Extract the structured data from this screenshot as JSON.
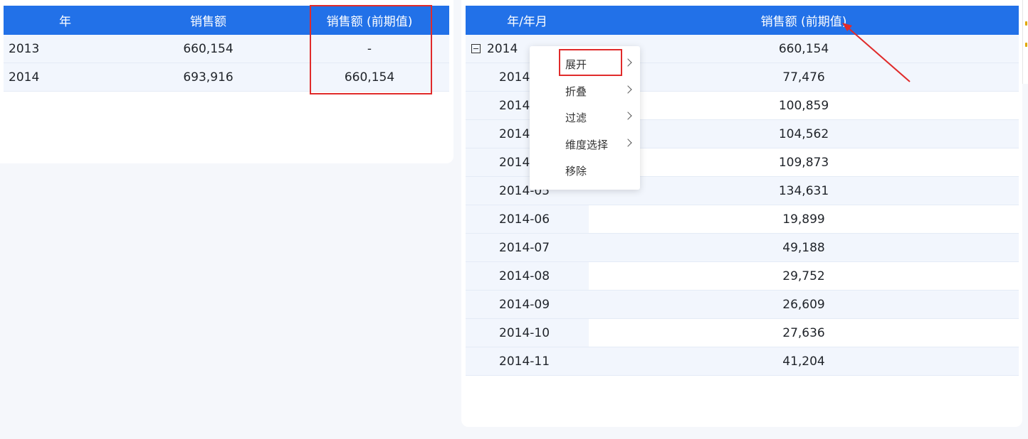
{
  "left_table": {
    "columns": [
      "年",
      "销售额",
      "销售额 (前期值)"
    ],
    "rows": [
      [
        "2013",
        "660,154",
        "-"
      ],
      [
        "2014",
        "693,916",
        "660,154"
      ]
    ]
  },
  "right_table": {
    "columns": [
      "年/年月",
      "销售额 (前期值)"
    ],
    "rows": [
      [
        "2014",
        "660,154"
      ],
      [
        "2014-01",
        "77,476"
      ],
      [
        "2014-02",
        "100,859"
      ],
      [
        "2014-03",
        "104,562"
      ],
      [
        "2014-04",
        "109,873"
      ],
      [
        "2014-05",
        "134,631"
      ],
      [
        "2014-06",
        "19,899"
      ],
      [
        "2014-07",
        "49,188"
      ],
      [
        "2014-08",
        "29,752"
      ],
      [
        "2014-09",
        "26,609"
      ],
      [
        "2014-10",
        "27,636"
      ],
      [
        "2014-11",
        "41,204"
      ]
    ]
  },
  "context_menu": {
    "items": [
      "展开",
      "折叠",
      "过滤",
      "维度选择",
      "移除"
    ]
  },
  "colors": {
    "header_bg": "#2271e8",
    "highlight": "#e02b2b"
  }
}
